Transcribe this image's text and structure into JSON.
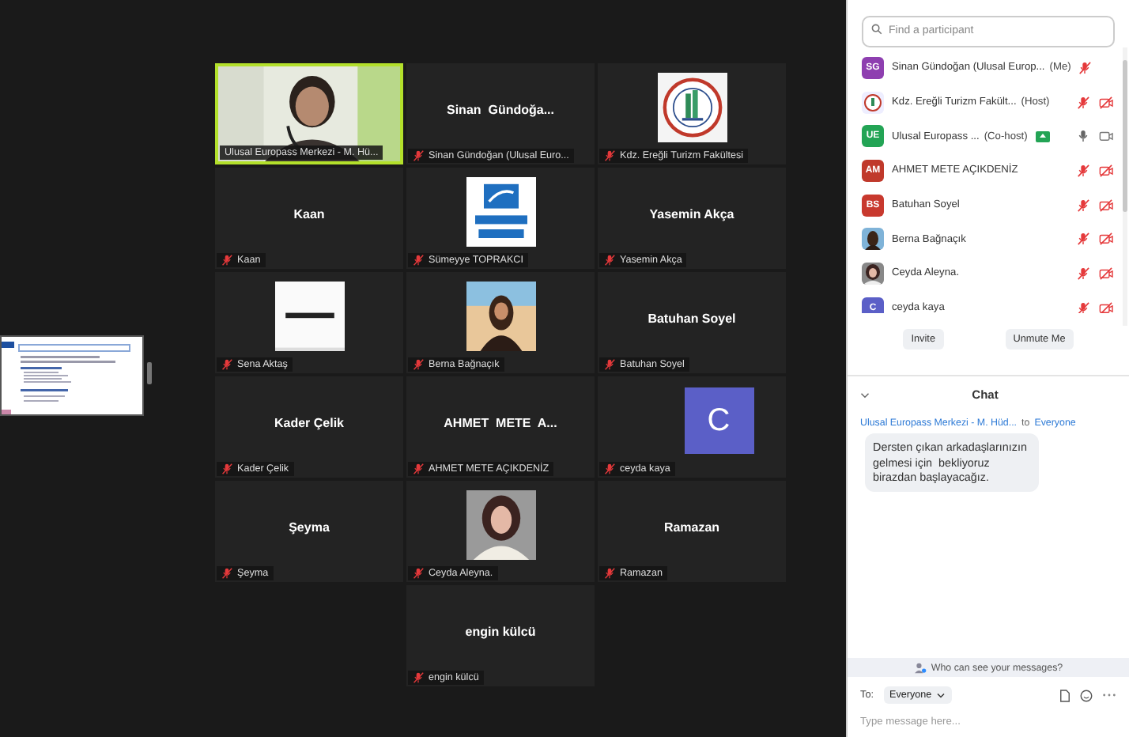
{
  "stage": {
    "tile_rows": [
      [
        {
          "kind": "video",
          "speaking": true,
          "muted": false,
          "label": "Ulusal Europass Merkezi - M. Hü..."
        },
        {
          "kind": "name",
          "speaking": false,
          "muted": true,
          "display": "Sinan  Gündoğa...",
          "label": "Sinan Gündoğan (Ulusal Euro..."
        },
        {
          "kind": "picture",
          "speaking": false,
          "muted": true,
          "label": "Kdz. Ereğli Turizm Fakültesi"
        }
      ],
      [
        {
          "kind": "name",
          "speaking": false,
          "muted": true,
          "display": "Kaan",
          "label": "Kaan"
        },
        {
          "kind": "picture",
          "speaking": false,
          "muted": true,
          "label": "Sümeyye TOPRAKCI"
        },
        {
          "kind": "name",
          "speaking": false,
          "muted": true,
          "display": "Yasemin Akça",
          "label": "Yasemin Akça"
        }
      ],
      [
        {
          "kind": "picture",
          "speaking": false,
          "muted": true,
          "label": "Sena Aktaş"
        },
        {
          "kind": "picture",
          "speaking": false,
          "muted": true,
          "label": "Berna Bağnaçık"
        },
        {
          "kind": "name",
          "speaking": false,
          "muted": true,
          "display": "Batuhan Soyel",
          "label": "Batuhan Soyel"
        }
      ],
      [
        {
          "kind": "name",
          "speaking": false,
          "muted": true,
          "display": "Kader Çelik",
          "label": "Kader Çelik"
        },
        {
          "kind": "name",
          "speaking": false,
          "muted": true,
          "display": "AHMET  METE  A...",
          "label": "AHMET METE AÇIKDENİZ"
        },
        {
          "kind": "letter",
          "speaking": false,
          "muted": true,
          "letter": "C",
          "color": "#5b5fc7",
          "label": "ceyda kaya"
        }
      ],
      [
        {
          "kind": "name",
          "speaking": false,
          "muted": true,
          "display": "Şeyma",
          "label": "Şeyma"
        },
        {
          "kind": "picture",
          "speaking": false,
          "muted": true,
          "label": "Ceyda Aleyna."
        },
        {
          "kind": "name",
          "speaking": false,
          "muted": true,
          "display": "Ramazan",
          "label": "Ramazan"
        }
      ],
      [
        {
          "kind": "name",
          "speaking": false,
          "muted": true,
          "display": "engin külcü",
          "label": "engin külcü"
        }
      ]
    ]
  },
  "participants": {
    "search": {
      "placeholder": "Find a participant"
    },
    "list": [
      {
        "kind": "initials",
        "initials": "SG",
        "color": "#8e3fb0",
        "name": "Sinan Gündoğan (Ulusal Europ...",
        "role": "(Me)",
        "sharing": false,
        "mic_muted": true
      },
      {
        "kind": "picture",
        "name": "Kdz. Ereğli Turizm Fakült...",
        "role": "(Host)",
        "sharing": false,
        "mic_muted": true,
        "video_off": true
      },
      {
        "kind": "initials",
        "initials": "UE",
        "color": "#23a455",
        "name": "Ulusal Europass ...",
        "role": "(Co-host)",
        "sharing": true,
        "mic_muted": false,
        "video_off": false
      },
      {
        "kind": "initials",
        "initials": "AM",
        "color": "#c0392b",
        "name": "AHMET METE AÇIKDENİZ",
        "sharing": false,
        "mic_muted": true,
        "video_off": true
      },
      {
        "kind": "initials",
        "initials": "BS",
        "color": "#c8392e",
        "name": "Batuhan Soyel",
        "sharing": false,
        "mic_muted": true,
        "video_off": true
      },
      {
        "kind": "picture",
        "name": "Berna Bağnaçık",
        "sharing": false,
        "mic_muted": true,
        "video_off": true
      },
      {
        "kind": "picture",
        "name": "Ceyda Aleyna.",
        "sharing": false,
        "mic_muted": true,
        "video_off": true
      },
      {
        "kind": "initials",
        "initials": "C",
        "color": "#5b5fc7",
        "name": "ceyda kaya",
        "sharing": false,
        "mic_muted": true,
        "video_off": true
      }
    ],
    "buttons": [
      "Invite",
      "Unmute Me"
    ]
  },
  "chat": {
    "title": "Chat",
    "messages": [
      {
        "sender": "Ulusal Europass Merkezi - M. Hüd...",
        "to": "to",
        "recipient": "Everyone",
        "text": "Dersten çıkan arkadaşlarınızın gelmesi için  bekliyoruz birazdan başlayacağız."
      }
    ],
    "privacy_note": "Who can see your messages?",
    "to_label": "To:",
    "recipient": "Everyone",
    "input": {
      "placeholder": "Type message here..."
    }
  }
}
